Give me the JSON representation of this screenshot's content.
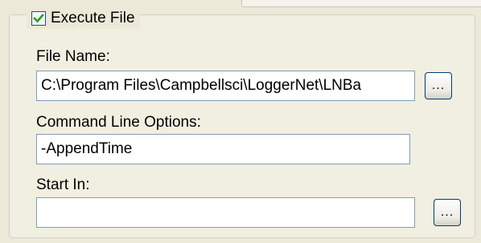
{
  "execute_file": {
    "label": "Execute File",
    "checked": true
  },
  "file_name": {
    "label": "File Name:",
    "value": "C:\\Program Files\\Campbellsci\\LoggerNet\\LNBa",
    "browse_label": "..."
  },
  "command_line_options": {
    "label": "Command Line Options:",
    "value": "-AppendTime"
  },
  "start_in": {
    "label": "Start In:",
    "value": "",
    "browse_label": "..."
  },
  "colors": {
    "check_mark": "#21a121",
    "textbox_border": "#7f9db9",
    "button_border": "#003c74"
  }
}
